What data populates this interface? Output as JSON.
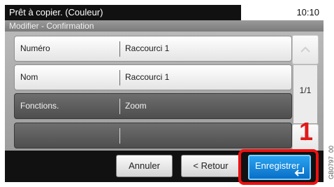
{
  "status": {
    "title": "Prêt à copier. (Couleur)",
    "time": "10:10"
  },
  "subtitle": "Modifier - Confirmation",
  "rows": [
    {
      "label": "Numéro",
      "value": "Raccourci 1"
    },
    {
      "label": "Nom",
      "value": "Raccourci 1"
    },
    {
      "label": "Fonctions.",
      "value": "Zoom"
    },
    {
      "label": "",
      "value": ""
    }
  ],
  "pager": {
    "page": "1/1"
  },
  "buttons": {
    "cancel": "Annuler",
    "back": "< Retour",
    "save": "Enregistrer"
  },
  "annotation": {
    "step": "1",
    "code": "GB0797_00"
  },
  "icons": [
    "chevron-up-icon",
    "chevron-down-icon",
    "enter-icon"
  ],
  "colors": {
    "highlight": "#ee1111",
    "save_button": "#1a8ce0",
    "status_bar": "#111111"
  }
}
